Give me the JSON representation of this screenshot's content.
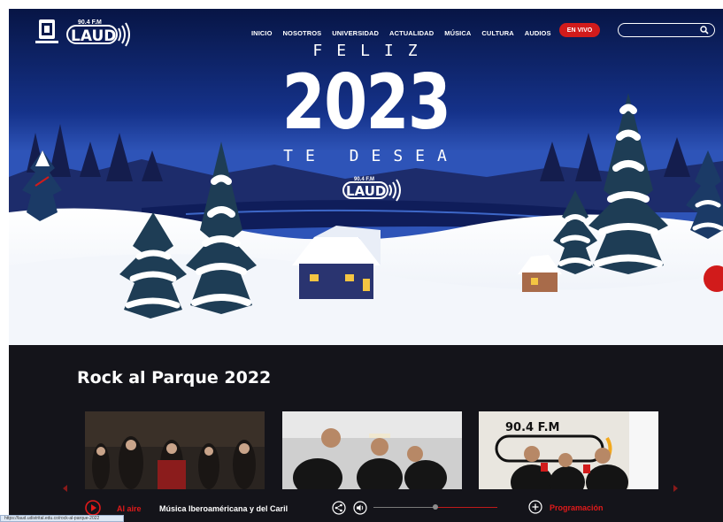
{
  "nav": {
    "crest_caption": "",
    "logo_frequency": "90.4 F.M",
    "logo_text": "LAUD",
    "menu": [
      "INICIO",
      "NOSOTROS",
      "UNIVERSIDAD",
      "ACTUALIDAD",
      "MÚSICA",
      "CULTURA",
      "AUDIOS"
    ],
    "live_label": "EN VIVO",
    "search_placeholder": "",
    "search_icon": "search-icon"
  },
  "hero": {
    "line1": "FELIZ",
    "year": "2023",
    "line2": "TE DESEA",
    "logo_frequency": "90.4 F.M",
    "logo_text": "LAUD"
  },
  "section": {
    "title": "Rock al Parque 2022",
    "cards": [
      "card-1",
      "card-2",
      "card-3"
    ]
  },
  "player": {
    "on_air_label": "Al aire",
    "program_name": "Música Iberoaméricana y del Caril",
    "schedule_label": "Programación",
    "volume_level": 0.5
  },
  "status_bar": {
    "url": "https://laud.udistrital.edu.co/rock-al-parque-2022"
  },
  "colors": {
    "accent_red": "#d11b1b",
    "dark_bg": "#14141a",
    "sky_dark": "#0b1a4d"
  }
}
